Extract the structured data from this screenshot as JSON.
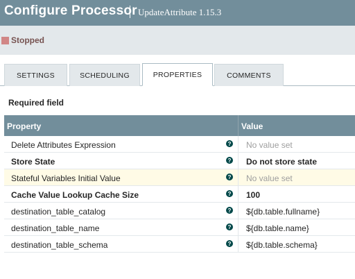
{
  "dialog": {
    "title": "Configure Processor",
    "subtitle": "UpdateAttribute 1.15.3"
  },
  "status": {
    "label": "Stopped",
    "color": "#d18686"
  },
  "tabs": [
    {
      "label": "SETTINGS",
      "active": false
    },
    {
      "label": "SCHEDULING",
      "active": false
    },
    {
      "label": "PROPERTIES",
      "active": true
    },
    {
      "label": "COMMENTS",
      "active": false
    }
  ],
  "properties": {
    "required_label": "Required field",
    "headers": {
      "property": "Property",
      "value": "Value"
    },
    "rows": [
      {
        "name": "Delete Attributes Expression",
        "value": "No value set",
        "required": false,
        "empty": true
      },
      {
        "name": "Store State",
        "value": "Do not store state",
        "required": true,
        "empty": false
      },
      {
        "name": "Stateful Variables Initial Value",
        "value": "No value set",
        "required": false,
        "empty": true
      },
      {
        "name": "Cache Value Lookup Cache Size",
        "value": "100",
        "required": true,
        "empty": false
      },
      {
        "name": "destination_table_catalog",
        "value": "${db.table.fullname}",
        "required": false,
        "empty": false
      },
      {
        "name": "destination_table_name",
        "value": "${db.table.name}",
        "required": false,
        "empty": false
      },
      {
        "name": "destination_table_schema",
        "value": "${db.table.schema}",
        "required": false,
        "empty": false
      }
    ],
    "help_icon": "question-circle-icon"
  },
  "colors": {
    "header_bg": "#728e9b",
    "status_bar_bg": "#e3e8eb",
    "highlight_row": "#fffbe6",
    "help_icon": "#004849"
  }
}
